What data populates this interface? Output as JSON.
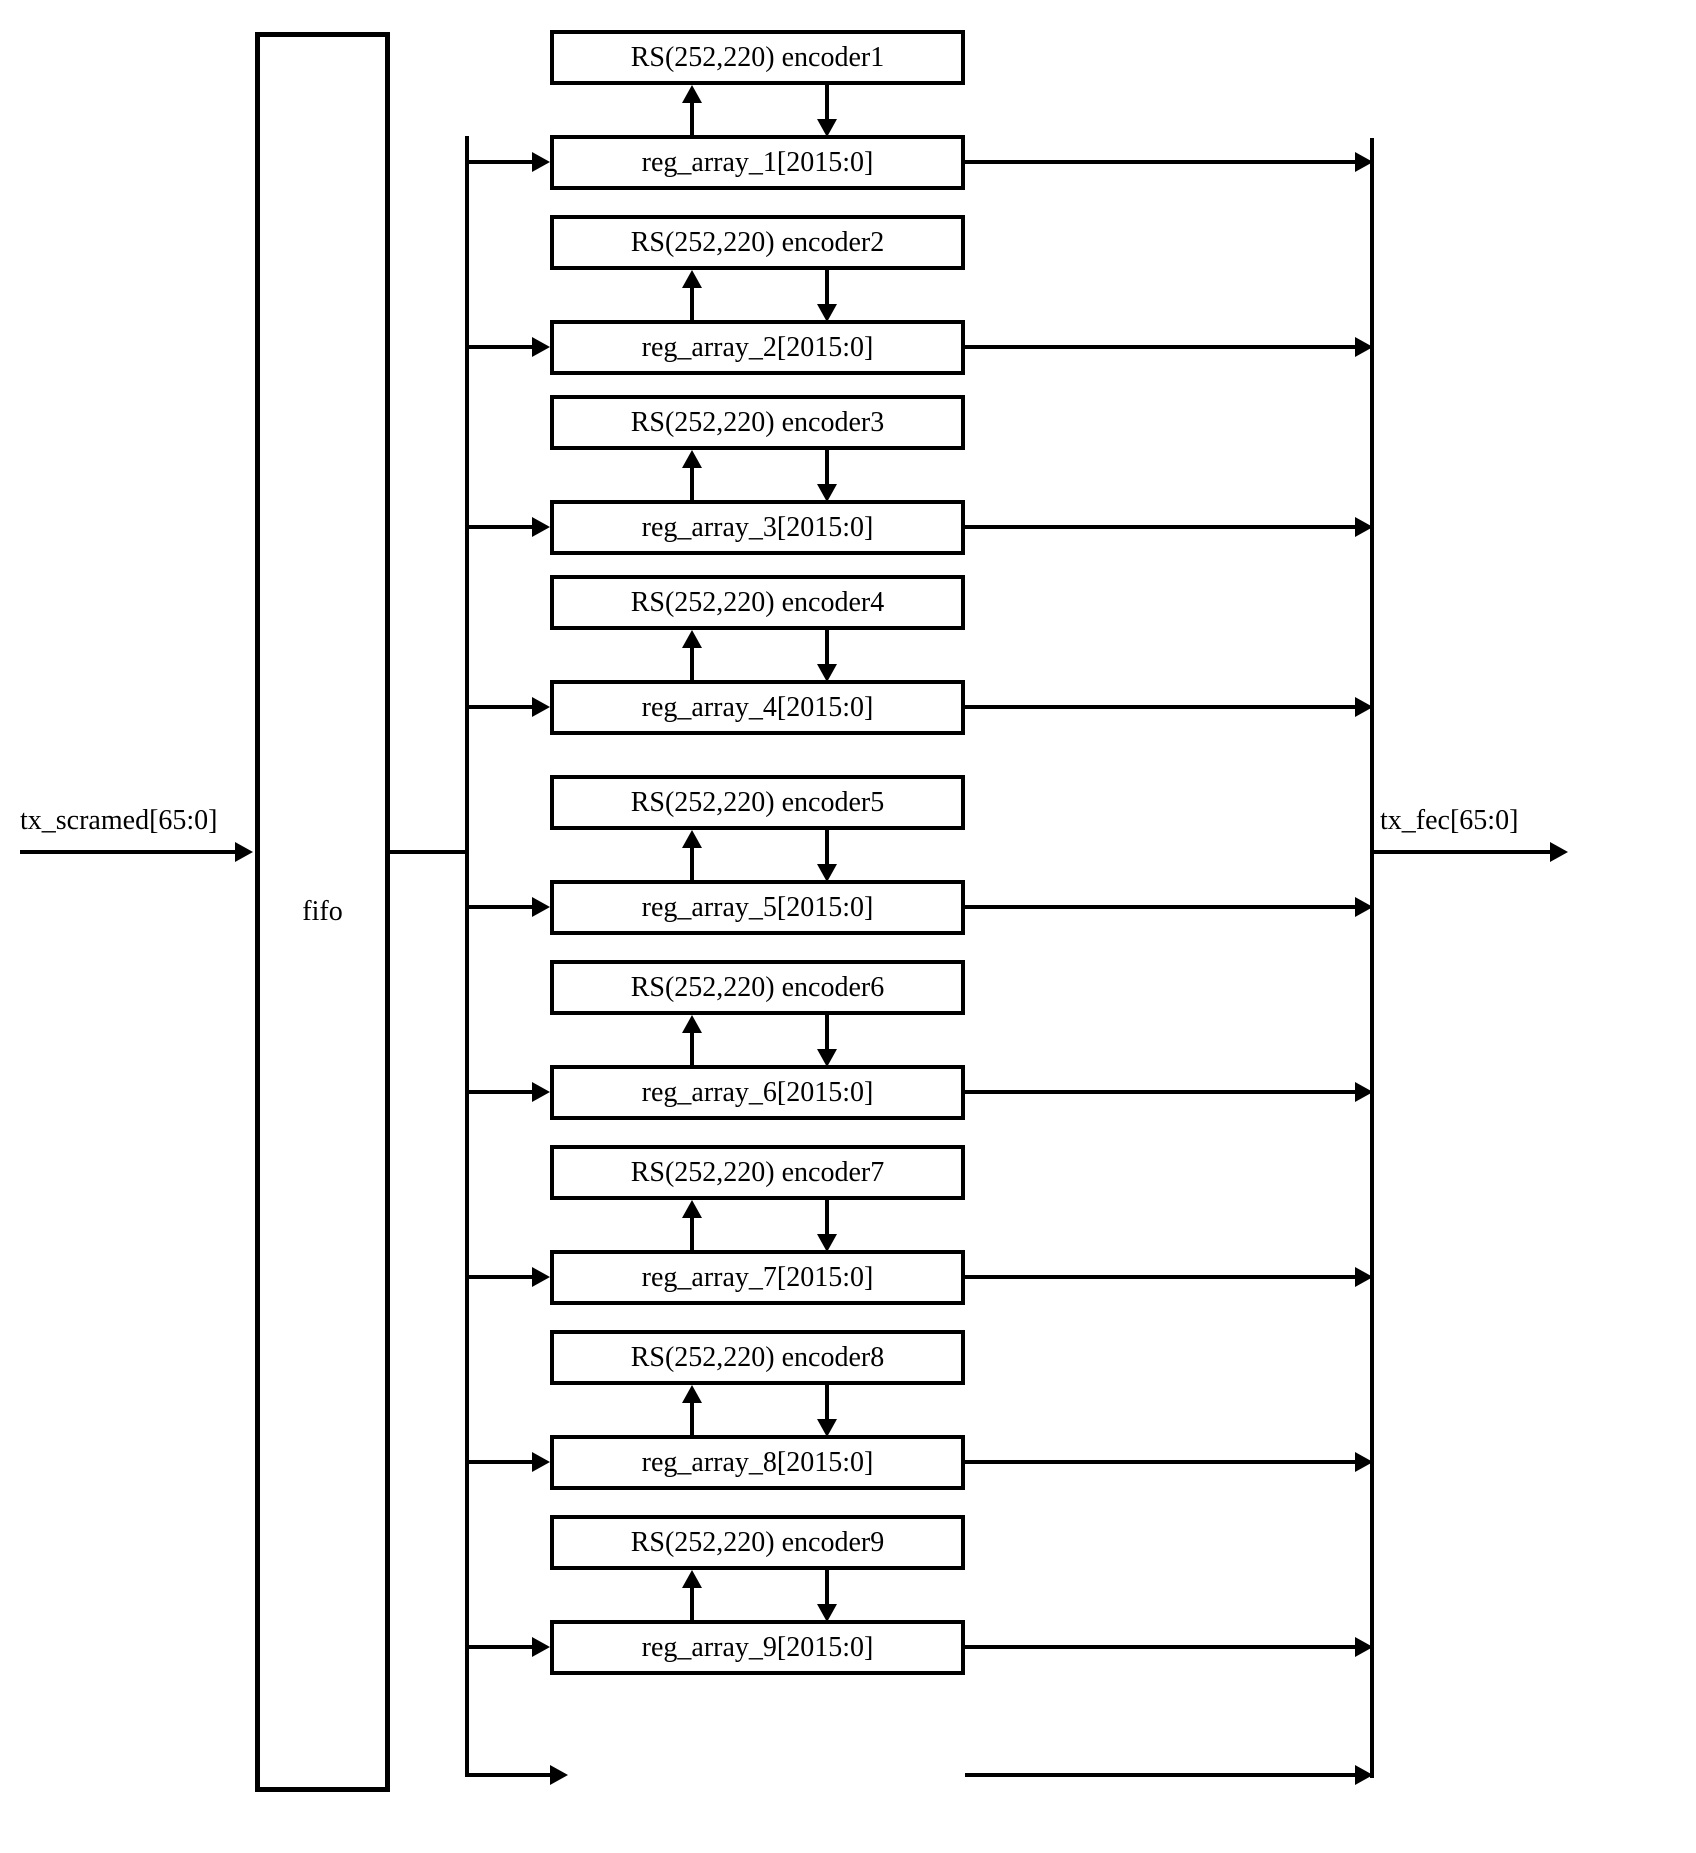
{
  "input_label": "tx_scramed[65:0]",
  "output_label": "tx_fec[65:0]",
  "fifo_label": "fifo",
  "blocks": [
    {
      "encoder": "RS(252,220) encoder1",
      "reg": "reg_array_1[2015:0]"
    },
    {
      "encoder": "RS(252,220) encoder2",
      "reg": "reg_array_2[2015:0]"
    },
    {
      "encoder": "RS(252,220) encoder3",
      "reg": "reg_array_3[2015:0]"
    },
    {
      "encoder": "RS(252,220) encoder4",
      "reg": "reg_array_4[2015:0]"
    },
    {
      "encoder": "RS(252,220) encoder5",
      "reg": "reg_array_5[2015:0]"
    },
    {
      "encoder": "RS(252,220) encoder6",
      "reg": "reg_array_6[2015:0]"
    },
    {
      "encoder": "RS(252,220) encoder7",
      "reg": "reg_array_7[2015:0]"
    },
    {
      "encoder": "RS(252,220) encoder8",
      "reg": "reg_array_8[2015:0]"
    },
    {
      "encoder": "RS(252,220) encoder9",
      "reg": "reg_array_9[2015:0]"
    }
  ]
}
